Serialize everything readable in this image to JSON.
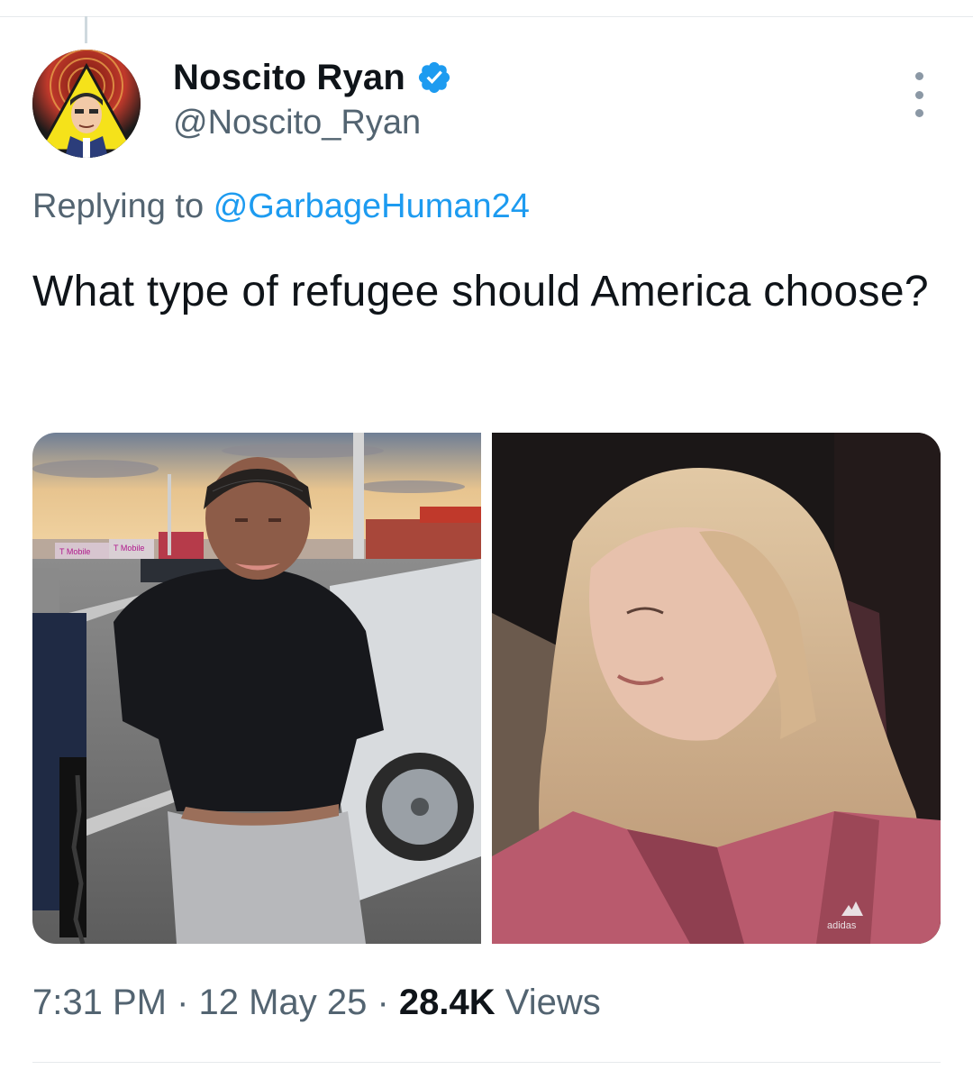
{
  "author": {
    "display_name": "Noscito Ryan",
    "handle": "@Noscito_Ryan",
    "verified": true,
    "verified_color": "#1d9bf0"
  },
  "reply": {
    "prefix": "Replying to",
    "mention": "@GarbageHuman24"
  },
  "tweet": {
    "text": "What type of refugee should America choose?"
  },
  "media": {
    "photos": [
      {
        "id": "photo-1",
        "shop_sign": "T Mobile",
        "shop_sign_2": "T Mobile"
      },
      {
        "id": "photo-2",
        "logo_text": "adidas"
      }
    ]
  },
  "meta": {
    "time": "7:31 PM",
    "separator": "·",
    "date": "12 May 25",
    "views_count": "28.4K",
    "views_label": "Views"
  },
  "icons": {
    "more": "more-dots-icon",
    "verified": "verified-badge-icon"
  },
  "colors": {
    "link": "#1d9bf0",
    "secondary_text": "#536471",
    "primary_text": "#0f1419"
  }
}
